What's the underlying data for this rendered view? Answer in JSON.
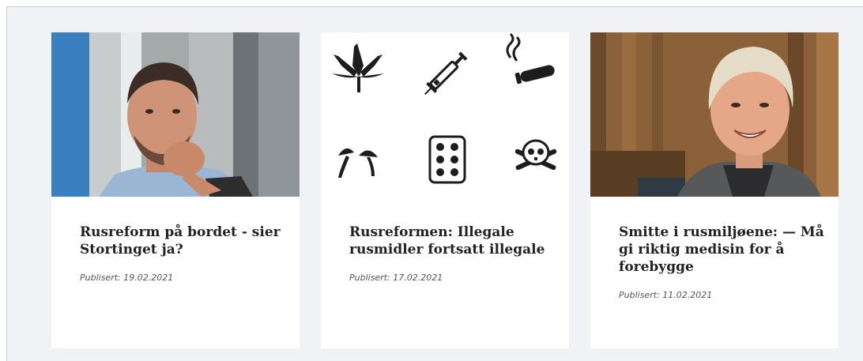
{
  "articles": [
    {
      "title": "Rusreform på bordet - sier Stortinget ja?",
      "published": "Publisert: 19.02.2021",
      "image_icon": "man-thinking-photo"
    },
    {
      "title": "Rusreformen: Illegale rusmidler fortsatt illegale",
      "published": "Publisert: 17.02.2021",
      "image_icon": "drug-icons-illustration"
    },
    {
      "title": "Smitte i rusmiljøene: — Må gi riktig medisin for å forebygge",
      "published": "Publisert: 11.02.2021",
      "image_icon": "smiling-man-photo"
    }
  ],
  "colors": {
    "background": "#f1f2f6",
    "card": "#ffffff",
    "title": "#222222",
    "date": "#555555"
  }
}
